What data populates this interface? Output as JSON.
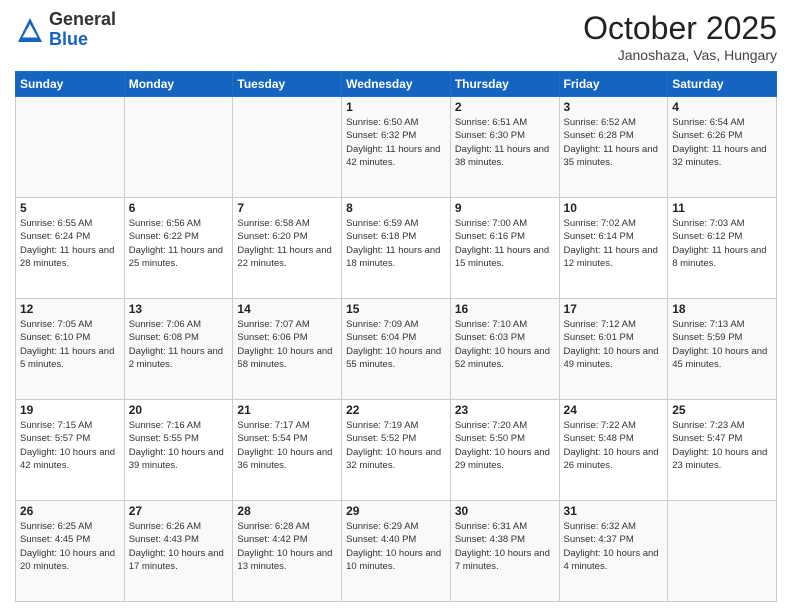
{
  "header": {
    "logo_general": "General",
    "logo_blue": "Blue",
    "title": "October 2025",
    "subtitle": "Janoshaza, Vas, Hungary"
  },
  "days_of_week": [
    "Sunday",
    "Monday",
    "Tuesday",
    "Wednesday",
    "Thursday",
    "Friday",
    "Saturday"
  ],
  "weeks": [
    [
      {
        "day": "",
        "detail": ""
      },
      {
        "day": "",
        "detail": ""
      },
      {
        "day": "",
        "detail": ""
      },
      {
        "day": "1",
        "detail": "Sunrise: 6:50 AM\nSunset: 6:32 PM\nDaylight: 11 hours\nand 42 minutes."
      },
      {
        "day": "2",
        "detail": "Sunrise: 6:51 AM\nSunset: 6:30 PM\nDaylight: 11 hours\nand 38 minutes."
      },
      {
        "day": "3",
        "detail": "Sunrise: 6:52 AM\nSunset: 6:28 PM\nDaylight: 11 hours\nand 35 minutes."
      },
      {
        "day": "4",
        "detail": "Sunrise: 6:54 AM\nSunset: 6:26 PM\nDaylight: 11 hours\nand 32 minutes."
      }
    ],
    [
      {
        "day": "5",
        "detail": "Sunrise: 6:55 AM\nSunset: 6:24 PM\nDaylight: 11 hours\nand 28 minutes."
      },
      {
        "day": "6",
        "detail": "Sunrise: 6:56 AM\nSunset: 6:22 PM\nDaylight: 11 hours\nand 25 minutes."
      },
      {
        "day": "7",
        "detail": "Sunrise: 6:58 AM\nSunset: 6:20 PM\nDaylight: 11 hours\nand 22 minutes."
      },
      {
        "day": "8",
        "detail": "Sunrise: 6:59 AM\nSunset: 6:18 PM\nDaylight: 11 hours\nand 18 minutes."
      },
      {
        "day": "9",
        "detail": "Sunrise: 7:00 AM\nSunset: 6:16 PM\nDaylight: 11 hours\nand 15 minutes."
      },
      {
        "day": "10",
        "detail": "Sunrise: 7:02 AM\nSunset: 6:14 PM\nDaylight: 11 hours\nand 12 minutes."
      },
      {
        "day": "11",
        "detail": "Sunrise: 7:03 AM\nSunset: 6:12 PM\nDaylight: 11 hours\nand 8 minutes."
      }
    ],
    [
      {
        "day": "12",
        "detail": "Sunrise: 7:05 AM\nSunset: 6:10 PM\nDaylight: 11 hours\nand 5 minutes."
      },
      {
        "day": "13",
        "detail": "Sunrise: 7:06 AM\nSunset: 6:08 PM\nDaylight: 11 hours\nand 2 minutes."
      },
      {
        "day": "14",
        "detail": "Sunrise: 7:07 AM\nSunset: 6:06 PM\nDaylight: 10 hours\nand 58 minutes."
      },
      {
        "day": "15",
        "detail": "Sunrise: 7:09 AM\nSunset: 6:04 PM\nDaylight: 10 hours\nand 55 minutes."
      },
      {
        "day": "16",
        "detail": "Sunrise: 7:10 AM\nSunset: 6:03 PM\nDaylight: 10 hours\nand 52 minutes."
      },
      {
        "day": "17",
        "detail": "Sunrise: 7:12 AM\nSunset: 6:01 PM\nDaylight: 10 hours\nand 49 minutes."
      },
      {
        "day": "18",
        "detail": "Sunrise: 7:13 AM\nSunset: 5:59 PM\nDaylight: 10 hours\nand 45 minutes."
      }
    ],
    [
      {
        "day": "19",
        "detail": "Sunrise: 7:15 AM\nSunset: 5:57 PM\nDaylight: 10 hours\nand 42 minutes."
      },
      {
        "day": "20",
        "detail": "Sunrise: 7:16 AM\nSunset: 5:55 PM\nDaylight: 10 hours\nand 39 minutes."
      },
      {
        "day": "21",
        "detail": "Sunrise: 7:17 AM\nSunset: 5:54 PM\nDaylight: 10 hours\nand 36 minutes."
      },
      {
        "day": "22",
        "detail": "Sunrise: 7:19 AM\nSunset: 5:52 PM\nDaylight: 10 hours\nand 32 minutes."
      },
      {
        "day": "23",
        "detail": "Sunrise: 7:20 AM\nSunset: 5:50 PM\nDaylight: 10 hours\nand 29 minutes."
      },
      {
        "day": "24",
        "detail": "Sunrise: 7:22 AM\nSunset: 5:48 PM\nDaylight: 10 hours\nand 26 minutes."
      },
      {
        "day": "25",
        "detail": "Sunrise: 7:23 AM\nSunset: 5:47 PM\nDaylight: 10 hours\nand 23 minutes."
      }
    ],
    [
      {
        "day": "26",
        "detail": "Sunrise: 6:25 AM\nSunset: 4:45 PM\nDaylight: 10 hours\nand 20 minutes."
      },
      {
        "day": "27",
        "detail": "Sunrise: 6:26 AM\nSunset: 4:43 PM\nDaylight: 10 hours\nand 17 minutes."
      },
      {
        "day": "28",
        "detail": "Sunrise: 6:28 AM\nSunset: 4:42 PM\nDaylight: 10 hours\nand 13 minutes."
      },
      {
        "day": "29",
        "detail": "Sunrise: 6:29 AM\nSunset: 4:40 PM\nDaylight: 10 hours\nand 10 minutes."
      },
      {
        "day": "30",
        "detail": "Sunrise: 6:31 AM\nSunset: 4:38 PM\nDaylight: 10 hours\nand 7 minutes."
      },
      {
        "day": "31",
        "detail": "Sunrise: 6:32 AM\nSunset: 4:37 PM\nDaylight: 10 hours\nand 4 minutes."
      },
      {
        "day": "",
        "detail": ""
      }
    ]
  ]
}
